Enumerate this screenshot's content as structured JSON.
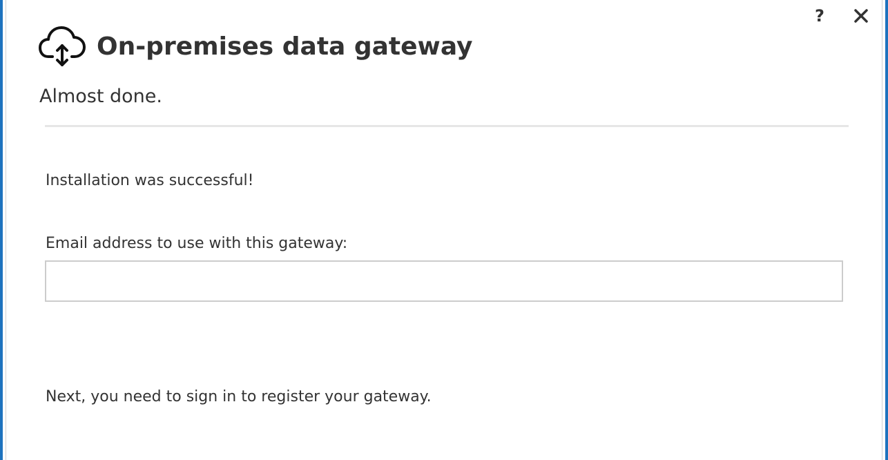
{
  "window": {
    "title": "On-premises data gateway",
    "help_label": "?",
    "close_label": "✕",
    "accent_color": "#1e73be"
  },
  "header": {
    "icon": "cloud-upload-download-icon",
    "title": "On-premises data gateway"
  },
  "main": {
    "subtitle": "Almost done.",
    "success_message": "Installation was successful!",
    "email_label": "Email address to use with this gateway:",
    "email_value": "",
    "email_placeholder": "",
    "next_message": "Next, you need to sign in to register your gateway."
  }
}
